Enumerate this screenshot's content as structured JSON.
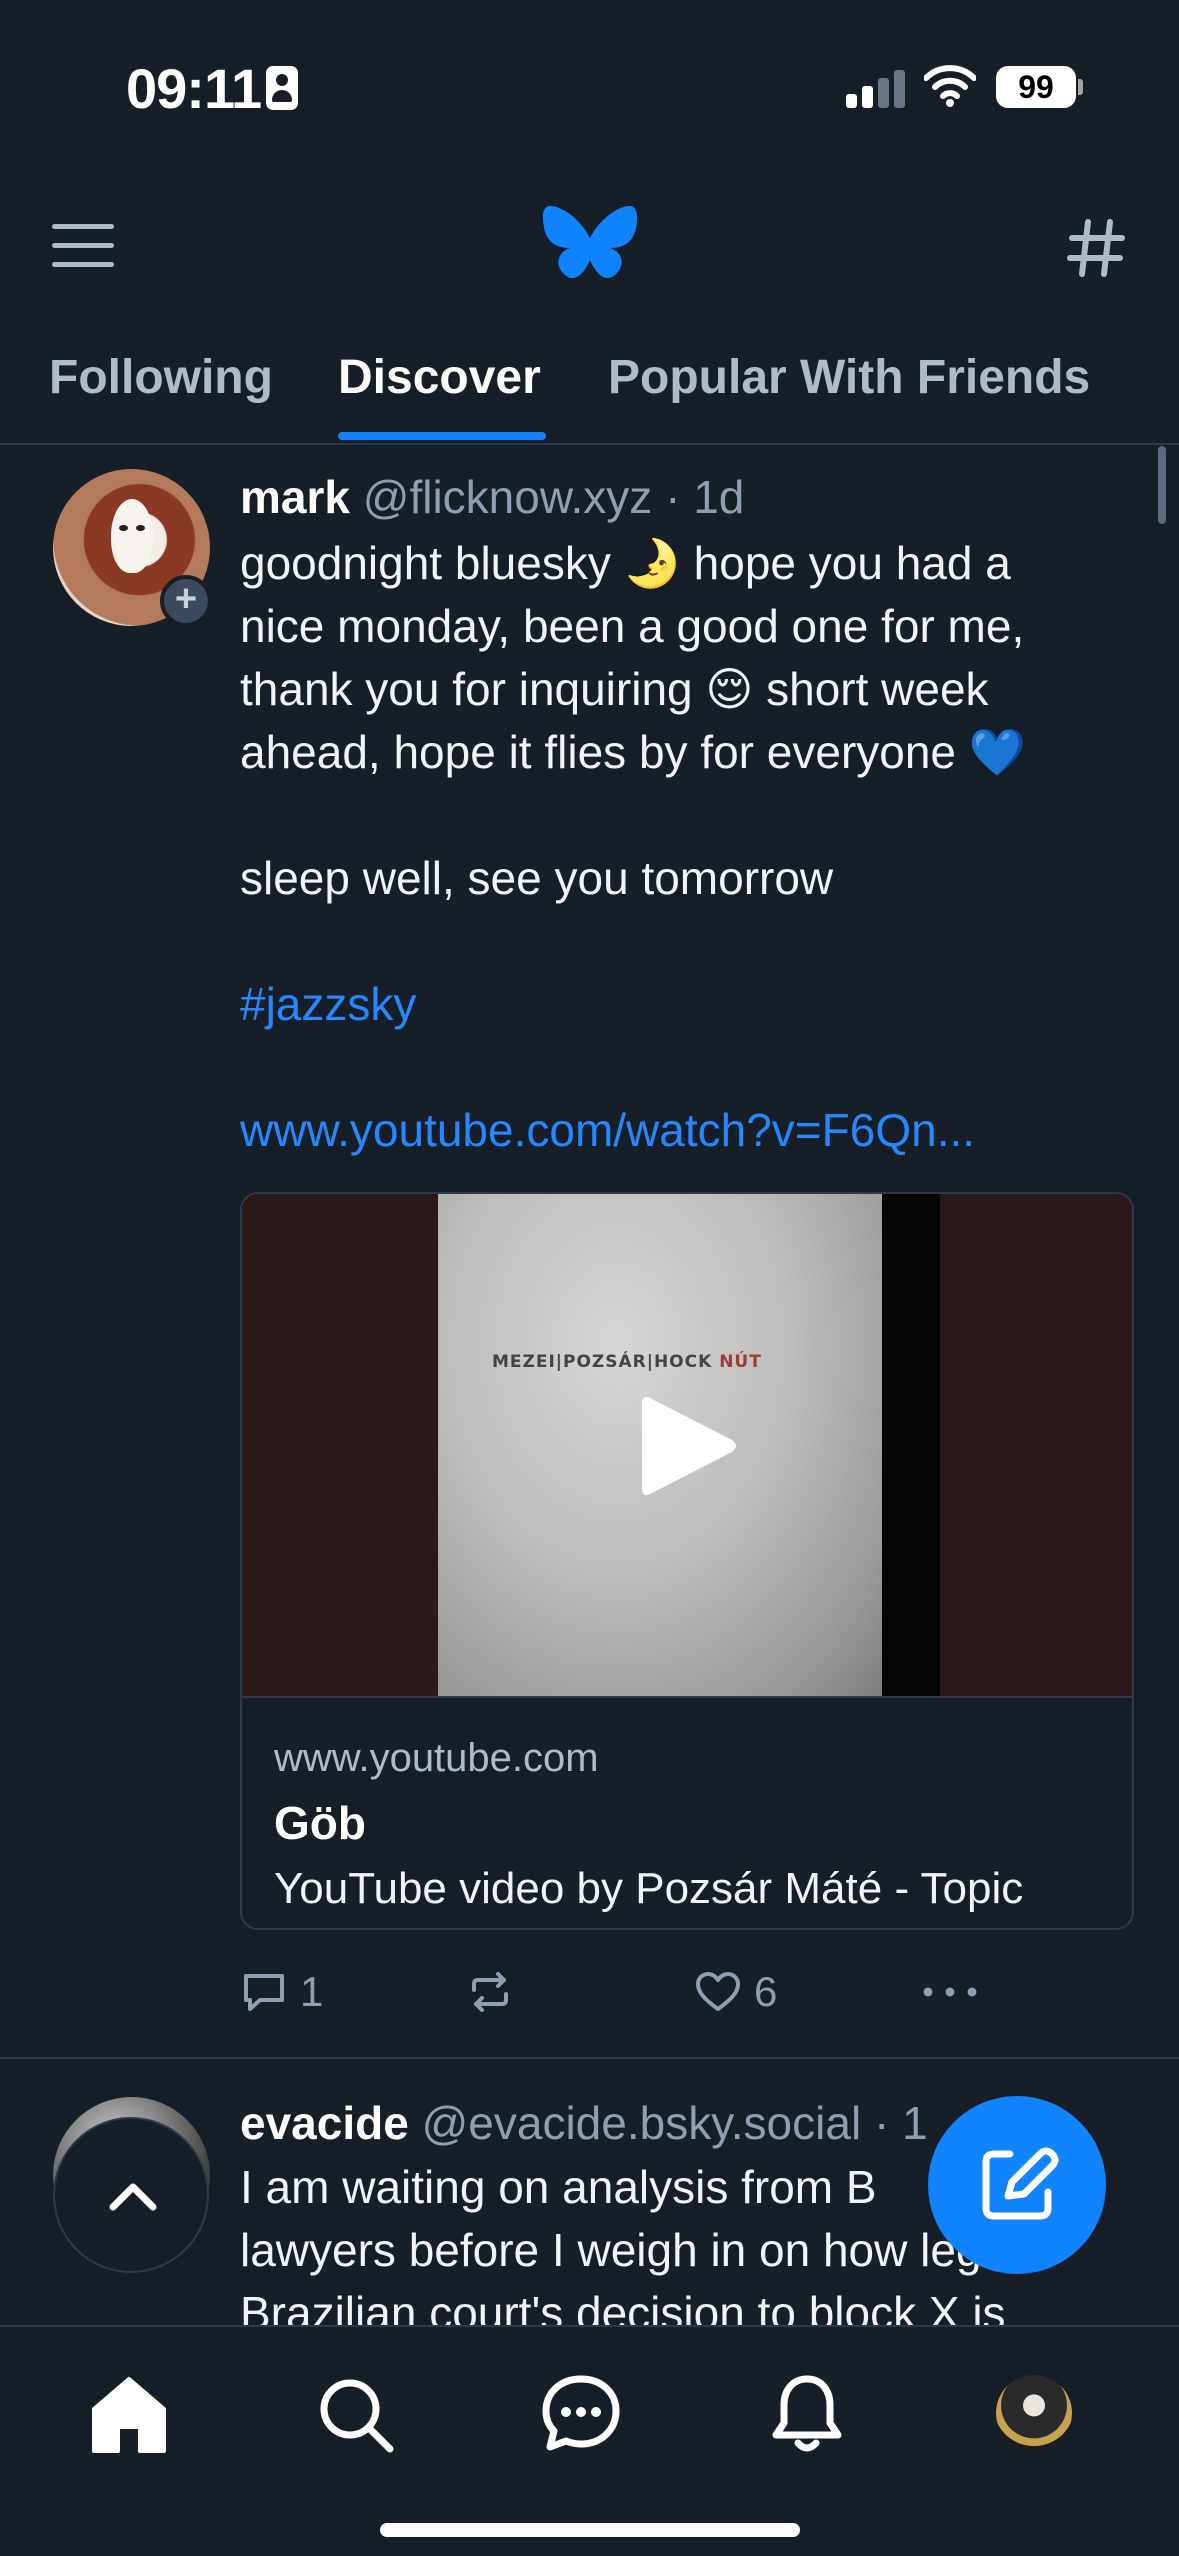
{
  "status_bar": {
    "time": "09:11",
    "battery": "99"
  },
  "tabs": [
    {
      "label": "Following"
    },
    {
      "label": "Discover"
    },
    {
      "label": "Popular With Friends"
    }
  ],
  "posts": [
    {
      "author": "mark",
      "handle": "@flicknow.xyz",
      "separator": "·",
      "age": "1d",
      "lines": [
        "goodnight bluesky 🌛 hope you had a",
        "nice monday, been a good one for me,",
        "thank you for inquiring 😌 short week",
        "ahead, hope it flies by for everyone 💙"
      ],
      "line2": "sleep well, see you tomorrow",
      "hashtag": "#jazzsky",
      "link": "www.youtube.com/watch?v=F6Qn...",
      "embed": {
        "album_artists": "MEZEI|POZSÁR|HOCK",
        "album_title": "NÚT",
        "domain": "www.youtube.com",
        "title": "Göb",
        "description": "YouTube video by Pozsár Máté - Topic"
      },
      "reply_count": "1",
      "like_count": "6"
    },
    {
      "author": "evacide",
      "handle": "@evacide.bsky.social",
      "separator": "·",
      "age": "1",
      "lines": [
        "I am waiting on analysis from B",
        "lawyers before I weigh in on how legal",
        "Brazilian court's decision to block X is"
      ]
    }
  ],
  "colors": {
    "background": "#161e27",
    "accent": "#1083fe",
    "link": "#2588ff",
    "muted_text": "#8f9fb1",
    "border": "#2c3a4b"
  },
  "icons": {
    "menu": "hamburger-icon",
    "logo": "butterfly-logo",
    "feeds": "hash-icon",
    "reply": "comment-icon",
    "repost": "repost-icon",
    "like": "heart-icon",
    "more": "ellipsis-icon",
    "compose": "compose-icon",
    "scroll_top": "chevron-up-icon"
  }
}
